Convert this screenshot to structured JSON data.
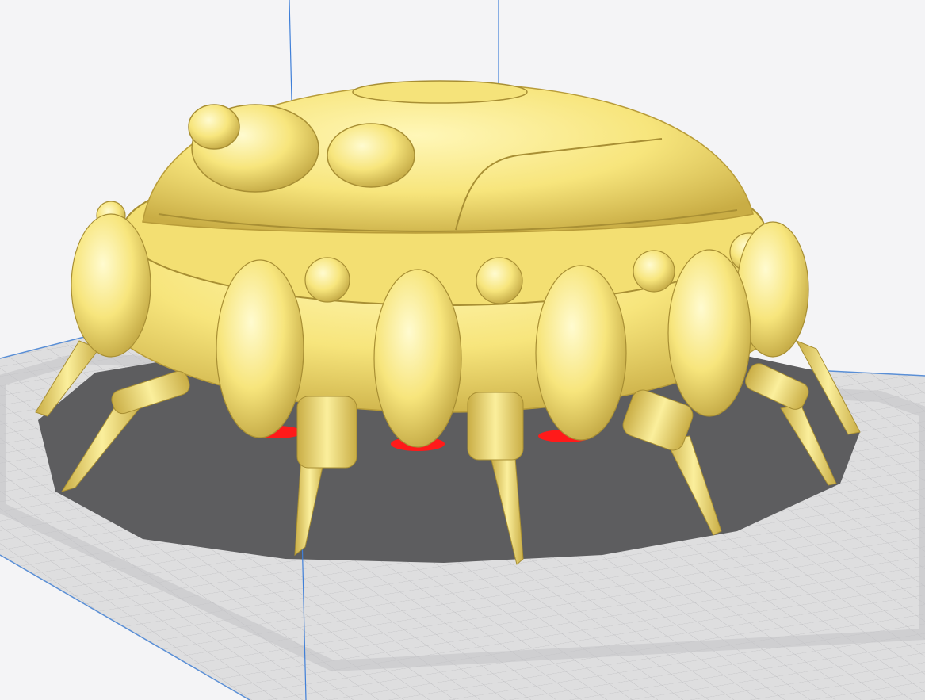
{
  "app": "slicer-3d-viewport",
  "view": {
    "background_color": "#f4f4f6",
    "build_plate_color": "#d4d4d6",
    "plate_grid_color": "#a9a9ad",
    "plate_border_color": "#5a8fd6",
    "model_shadow_color": "#5d5d5f",
    "axis_line_color": "#3f7fd8"
  },
  "model": {
    "name": "",
    "description_icon": "ufo-model-with-spider-legs",
    "body_color": "#f7e57c",
    "body_shade_color": "#d2b850",
    "overhang_color": "#ff1a1a",
    "selected": false
  }
}
